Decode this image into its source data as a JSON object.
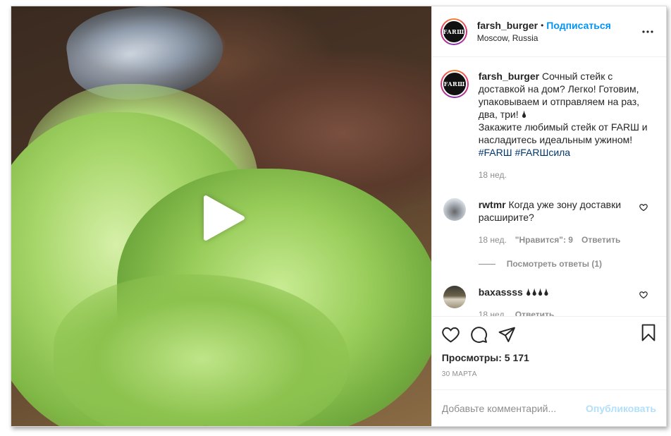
{
  "header": {
    "username": "farsh_burger",
    "separator": "•",
    "follow_label": "Подписаться",
    "location": "Moscow, Russia",
    "avatar_logo_text": "FARШ",
    "more_icon": "more-horizontal-icon"
  },
  "media": {
    "type": "video",
    "play_icon": "play-icon"
  },
  "caption": {
    "username": "farsh_burger",
    "text_line1": "Сочный стейк с доставкой на дом? Легко! Готовим, упаковываем и отправляем на раз, два, три! 🌢",
    "text_line2": "Закажите любимый стейк от FARШ и насладитесь идеальным ужином!",
    "hashtag1": "#FARШ",
    "hashtag2": "#FARШсила",
    "time": "18 нед."
  },
  "comments": [
    {
      "username": "rwtmr",
      "text": "Когда уже зону доставки расширите?",
      "time": "18 нед.",
      "likes": "\"Нравится\": 9",
      "reply_label": "Ответить",
      "view_replies": "Посмотреть ответы (1)"
    },
    {
      "username": "baxassss",
      "text": "🌢🌢🌢🌢",
      "time": "18 нед.",
      "reply_label": "Ответить"
    }
  ],
  "actions": {
    "views": "Просмотры: 5 171",
    "date": "30 МАРТА"
  },
  "add_comment": {
    "placeholder": "Добавьте комментарий...",
    "post_label": "Опубликовать"
  },
  "colors": {
    "accent": "#0095f6",
    "post_disabled": "#b2dffc",
    "meta_gray": "#8e8e8e",
    "hashtag": "#00376b"
  }
}
